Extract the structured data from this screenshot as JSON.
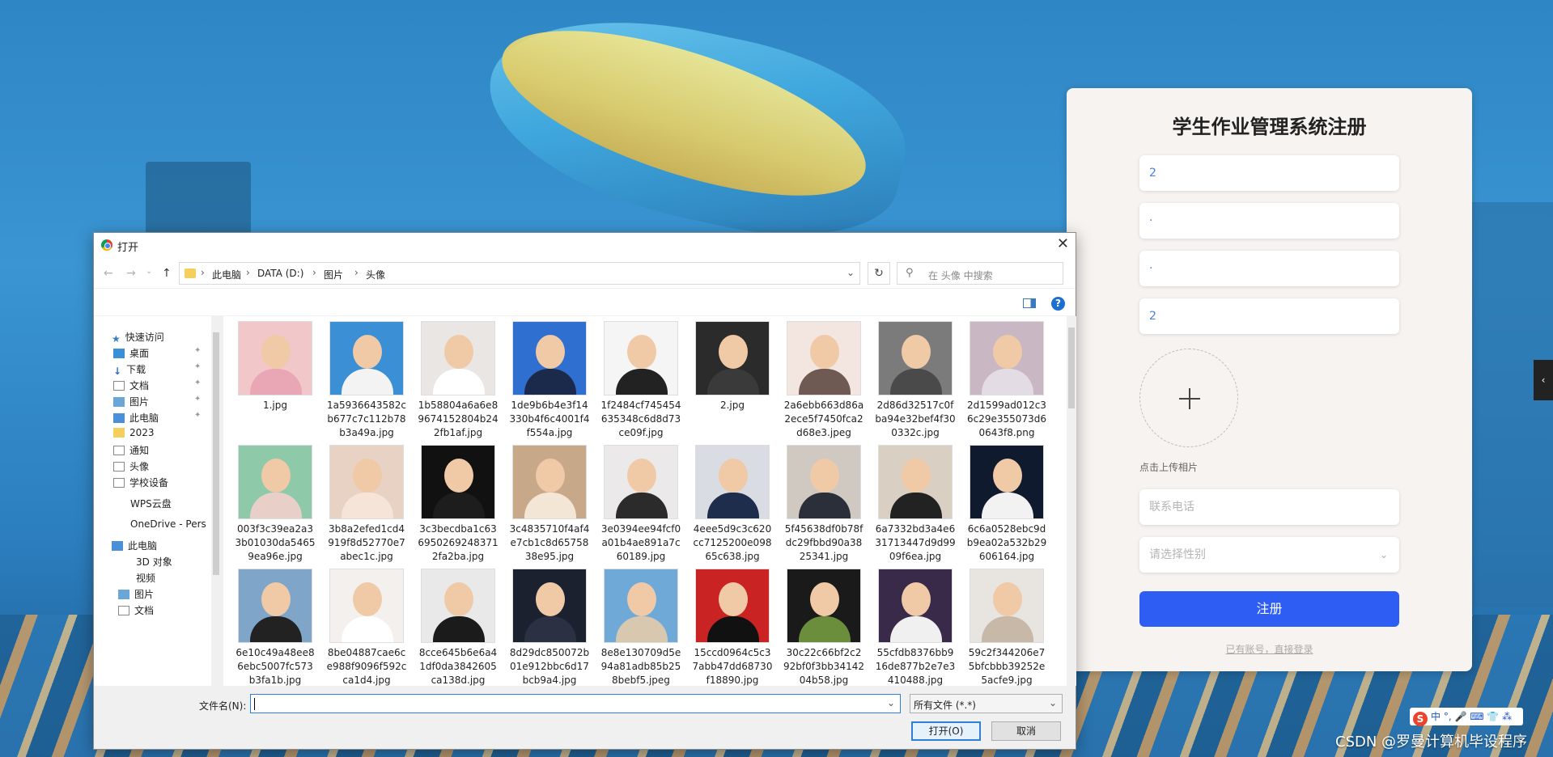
{
  "register": {
    "title": "学生作业管理系统注册",
    "field1_value": "2",
    "field2_value": "·",
    "field3_value": "·",
    "field4_value": "2",
    "upload_hint": "点击上传相片",
    "phone_placeholder": "联系电话",
    "gender_placeholder": "请选择性别",
    "submit_label": "注册",
    "login_link": "已有账号，直接登录"
  },
  "dialog": {
    "title": "打开",
    "breadcrumb": [
      "此电脑",
      "DATA (D:)",
      "图片",
      "头像"
    ],
    "search_placeholder": "在 头像 中搜索",
    "help": "?",
    "nav_items": [
      "快速访问",
      "桌面",
      "下载",
      "文档",
      "图片",
      "此电脑",
      "2023",
      "通知",
      "头像",
      "学校设备",
      "WPS云盘",
      "OneDrive - Pers",
      "此电脑",
      "3D 对象",
      "视频",
      "图片",
      "文档"
    ],
    "files": [
      {
        "name": "1.jpg",
        "bg": "#f2c7c9",
        "body": "#e9a7b5"
      },
      {
        "name": "1a5936643582cb677c7c112b78b3a49a.jpg",
        "bg": "#3b8fd4",
        "body": "#f3f3f3"
      },
      {
        "name": "1b58804a6a6e89674152804b242fb1af.jpg",
        "bg": "#e9e6e4",
        "body": "#ffffff"
      },
      {
        "name": "1de9b6b4e3f14330b4f6c4001f4f554a.jpg",
        "bg": "#2f6fd0",
        "body": "#1b2a4a"
      },
      {
        "name": "1f2484cf745454635348c6d8d73ce09f.jpg",
        "bg": "#f5f5f5",
        "body": "#222222"
      },
      {
        "name": "2.jpg",
        "bg": "#2b2b2b",
        "body": "#3a3a3a"
      },
      {
        "name": "2a6ebb663d86a2ece5f7450fca2d68e3.jpeg",
        "bg": "#f3e6e0",
        "body": "#6e5a52"
      },
      {
        "name": "2d86d32517c0fba94e32bef4f300332c.jpg",
        "bg": "#7b7b7b",
        "body": "#4a4a4a"
      },
      {
        "name": "2d1599ad012c36c29e355073d60643f8.png",
        "bg": "#c9b8c4",
        "body": "#e4dce4"
      },
      {
        "name": "003f3c39ea2a33b01030da54659ea96e.jpg",
        "bg": "#8ec9a9",
        "body": "#e8d0c8"
      },
      {
        "name": "3b8a2efed1cd4919f8d52770e7abec1c.jpg",
        "bg": "#e8d2c4",
        "body": "#f6e4d8"
      },
      {
        "name": "3c3becdba1c636950269248371 2fa2ba.jpg",
        "bg": "#111111",
        "body": "#1d1d1d"
      },
      {
        "name": "3c4835710f4af4e7cb1c8d6575838e95.jpg",
        "bg": "#c7a98a",
        "body": "#f4e6d4"
      },
      {
        "name": "3e0394ee94fcf0a01b4ae891a7c60189.jpg",
        "bg": "#ece9ea",
        "body": "#2b2b2b"
      },
      {
        "name": "4eee5d9c3c620cc7125200e09865c638.jpg",
        "bg": "#d9dde3",
        "body": "#1f2d4c"
      },
      {
        "name": "5f45638df0b78fdc29fbbd90a3825341.jpg",
        "bg": "#cfc9c2",
        "body": "#2a2f3a"
      },
      {
        "name": "6a7332bd3a4e631713447d9d9909f6ea.jpg",
        "bg": "#d9cfc3",
        "body": "#222222"
      },
      {
        "name": "6c6a0528ebc9db9ea02a532b29606164.jpg",
        "bg": "#0f1a2e",
        "body": "#f2f2f2"
      },
      {
        "name": "6e10c49a48ee86ebc5007fc573b3fa1b.jpg",
        "bg": "#7fa6c9",
        "body": "#222222"
      },
      {
        "name": "8be04887cae6ce988f9096f592cca1d4.jpg",
        "bg": "#f3f0ed",
        "body": "#ffffff"
      },
      {
        "name": "8cce645b6e6a41df0da3842605ca138d.jpg",
        "bg": "#e9e9e9",
        "body": "#1b1b1b"
      },
      {
        "name": "8d29dc850072b01e912bbc6d17bcb9a4.jpg",
        "bg": "#1c2130",
        "body": "#2b3142"
      },
      {
        "name": "8e8e130709d5e94a81adb85b258bebf5.jpeg",
        "bg": "#6fa9d8",
        "body": "#d8c8b0"
      },
      {
        "name": "15ccd0964c5c37abb47dd68730f18890.jpg",
        "bg": "#c92323",
        "body": "#111111"
      },
      {
        "name": "30c22c66bf2c292bf0f3bb3414204b58.jpg",
        "bg": "#1a1a1a",
        "body": "#6a8e3c"
      },
      {
        "name": "55cfdb8376bb916de877b2e7e3410488.jpg",
        "bg": "#3a2a4a",
        "body": "#f0f0f0"
      },
      {
        "name": "59c2f344206e75bfcbbb39252e5acfe9.jpg",
        "bg": "#e8e4e0",
        "body": "#c8b8a8"
      }
    ],
    "filename_label": "文件名(N):",
    "filename_value": "",
    "filetype": "所有文件 (*.*)",
    "open_label": "打开(O)",
    "cancel_label": "取消"
  },
  "ime": {
    "logo": "S",
    "text": "中 °, 🎤 ⌨ 👕 ⁂"
  },
  "watermark": "CSDN @罗曼计算机毕设程序",
  "side_tab": "‹"
}
